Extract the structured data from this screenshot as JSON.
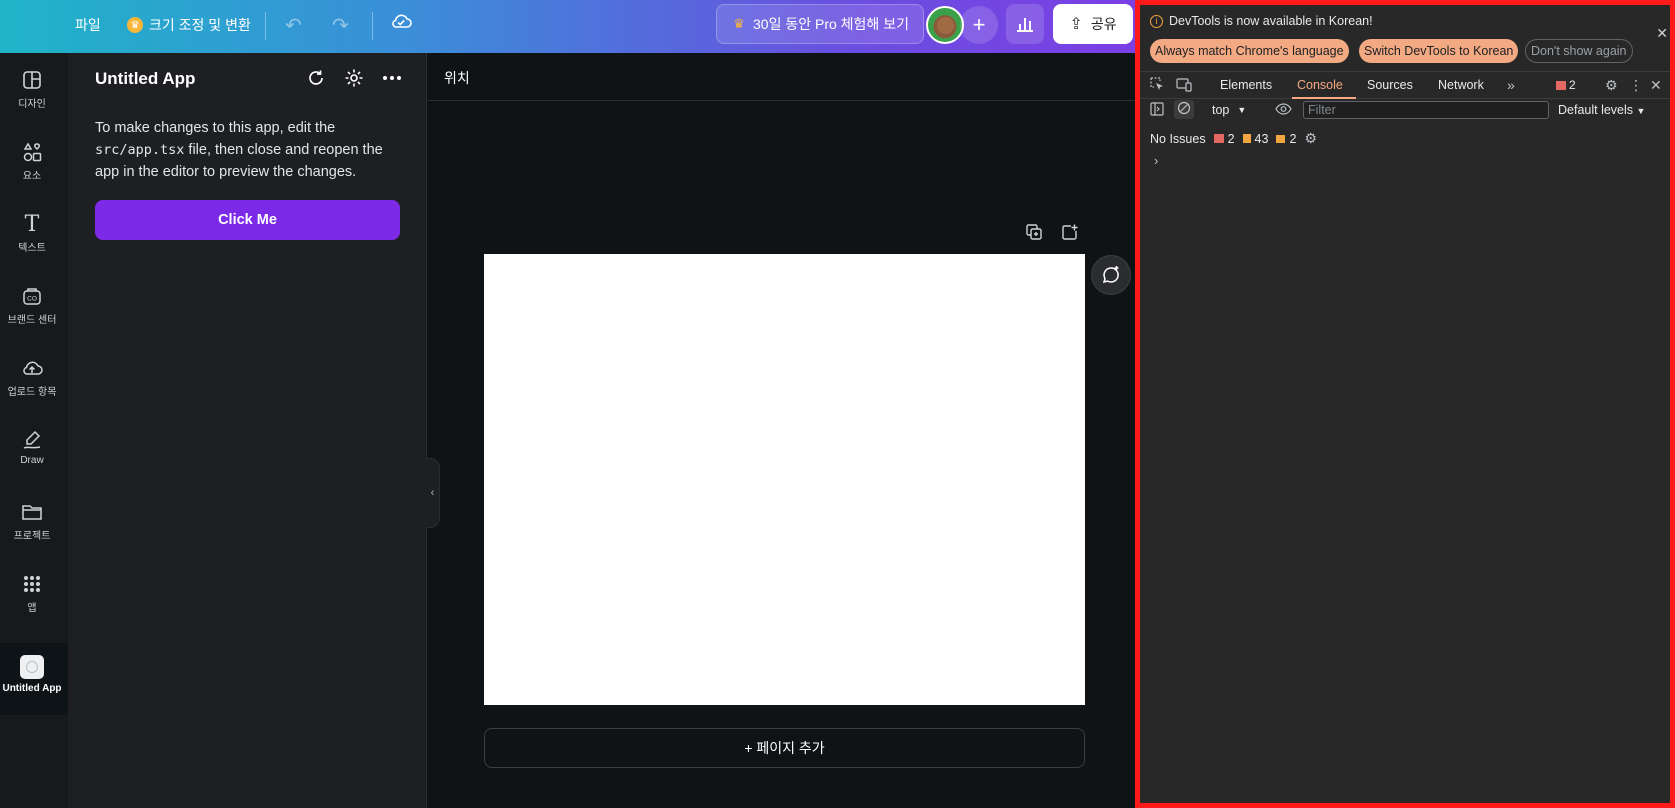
{
  "topbar": {
    "file_label": "파일",
    "resize_label": "크기 조정 및 변환",
    "pro_label": "30일 동안 Pro 체험해 보기",
    "share_label": "공유"
  },
  "rail": {
    "items": [
      {
        "label": "디자인",
        "icon": "design-icon"
      },
      {
        "label": "요소",
        "icon": "elements-icon"
      },
      {
        "label": "텍스트",
        "icon": "text-icon"
      },
      {
        "label": "브랜드 센터",
        "icon": "brand-icon"
      },
      {
        "label": "업로드 항목",
        "icon": "upload-icon"
      },
      {
        "label": "Draw",
        "icon": "draw-icon"
      },
      {
        "label": "프로젝트",
        "icon": "folder-icon"
      },
      {
        "label": "앱",
        "icon": "apps-icon"
      }
    ],
    "active_app_label": "Untitled App"
  },
  "panel": {
    "title": "Untitled App",
    "desc_before": "To make changes to this app, edit the ",
    "desc_code": "src/app.tsx",
    "desc_after": " file, then close and reopen the app in the editor to preview the changes.",
    "button_label": "Click Me"
  },
  "canvas": {
    "position_label": "위치",
    "add_page_label": "+ 페이지 추가"
  },
  "devtools": {
    "banner_text": "DevTools is now available in Korean!",
    "chip_match": "Always match Chrome's language",
    "chip_switch": "Switch DevTools to Korean",
    "chip_dismiss": "Don't show again",
    "tabs": [
      "Elements",
      "Console",
      "Sources",
      "Network"
    ],
    "active_tab": "Console",
    "error_count": "2",
    "context": "top",
    "filter_placeholder": "Filter",
    "levels_label": "Default levels",
    "issues_label": "No Issues",
    "issue_errors": "2",
    "issue_warnings": "43",
    "issue_messages": "2",
    "prompt_glyph": "›"
  },
  "colors": {
    "accent_purple": "#7d2ae8",
    "devtools_accent": "#f3a982",
    "highlight_border": "#ff1a1a"
  }
}
